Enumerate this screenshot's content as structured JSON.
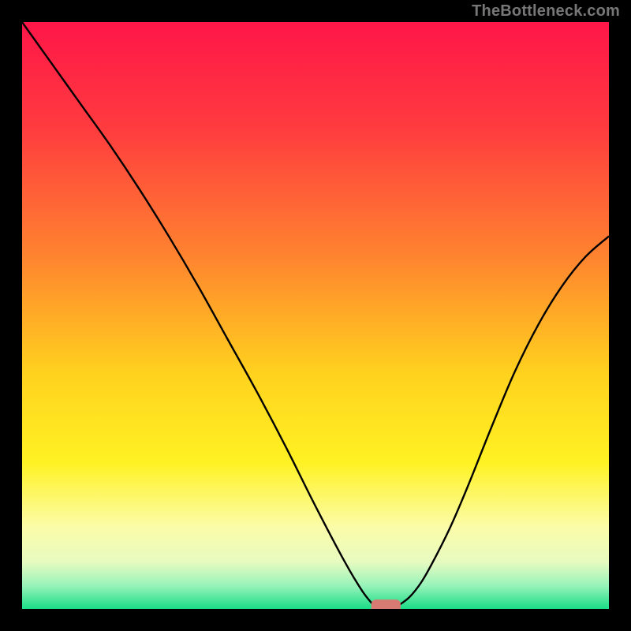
{
  "watermark": "TheBottleneck.com",
  "chart_data": {
    "type": "line",
    "title": "",
    "xlabel": "",
    "ylabel": "",
    "xlim": [
      0,
      100
    ],
    "ylim": [
      100,
      0
    ],
    "background_gradient": {
      "stops": [
        {
          "offset": 0,
          "color": "#ff1648"
        },
        {
          "offset": 18,
          "color": "#ff3b3f"
        },
        {
          "offset": 40,
          "color": "#ff842f"
        },
        {
          "offset": 60,
          "color": "#ffd21e"
        },
        {
          "offset": 75,
          "color": "#fff223"
        },
        {
          "offset": 86,
          "color": "#fbfca8"
        },
        {
          "offset": 92,
          "color": "#e7fbc0"
        },
        {
          "offset": 96,
          "color": "#98f3ba"
        },
        {
          "offset": 100,
          "color": "#1add87"
        }
      ]
    },
    "series": [
      {
        "name": "left-descent",
        "x": [
          0,
          5,
          10,
          15,
          20,
          25,
          30,
          35,
          40,
          45,
          50,
          55,
          58,
          60
        ],
        "y": [
          100,
          93,
          86,
          79,
          71.5,
          63.5,
          55,
          46,
          37,
          27.5,
          17.5,
          8,
          3,
          0.5
        ]
      },
      {
        "name": "right-ascent",
        "x": [
          64,
          66,
          68,
          70,
          73,
          76,
          80,
          84,
          88,
          92,
          96,
          100
        ],
        "y": [
          0.5,
          2,
          4.5,
          8,
          14,
          21,
          31,
          40.5,
          48.5,
          55,
          60,
          63.5
        ]
      }
    ],
    "marker": {
      "name": "optimum-marker",
      "x": 62,
      "y": 0.5,
      "width": 5,
      "height": 2.2,
      "color": "#d77a72"
    },
    "curve_color": "#000000",
    "curve_width": 2.4
  }
}
